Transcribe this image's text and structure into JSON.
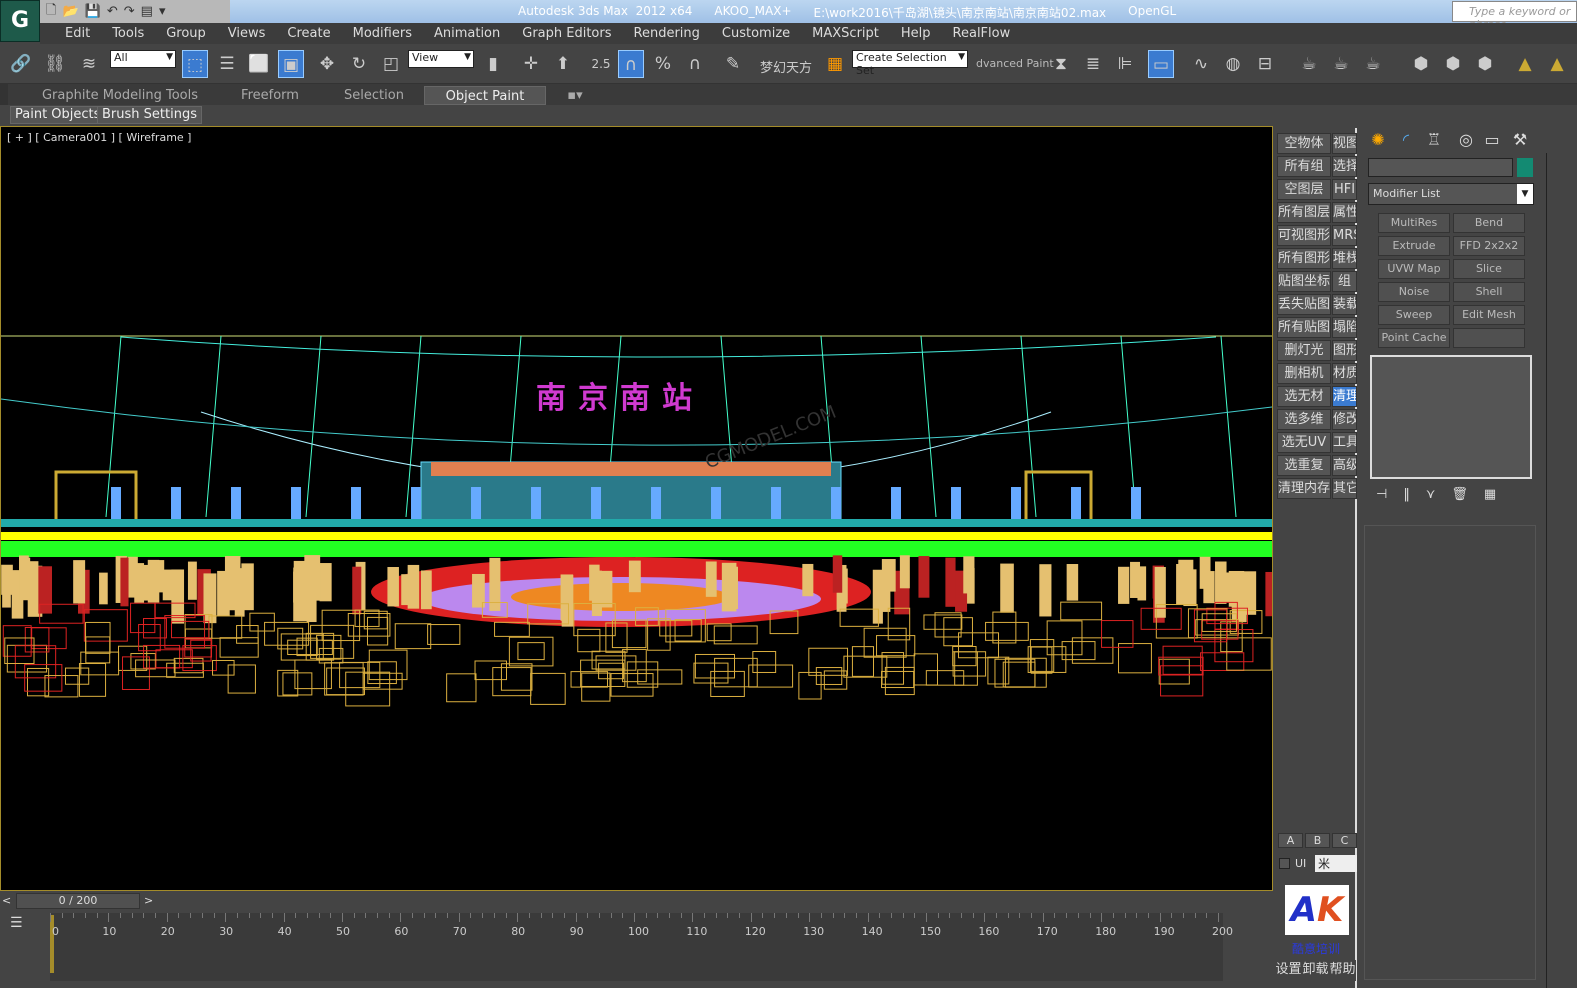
{
  "app": {
    "title_parts": [
      "Autodesk 3ds Max  2012 x64",
      "AKOO_MAX+",
      "E:\\work2016\\千岛湖\\镜头\\南京南站\\南京南站02.max",
      "OpenGL"
    ],
    "search_placeholder": "Type a keyword or phrase",
    "logo": "G"
  },
  "menu": [
    "Edit",
    "Tools",
    "Group",
    "Views",
    "Create",
    "Modifiers",
    "Animation",
    "Graph Editors",
    "Rendering",
    "Customize",
    "MAXScript",
    "Help",
    "RealFlow"
  ],
  "toolbar": {
    "filter_value": "All",
    "coord_value": "View",
    "snap_value": "2.5",
    "plugin_label": "梦幻天方",
    "selection_set_placeholder": "Create Selection Set",
    "advanced_paint": "dvanced Paint"
  },
  "ribbon": {
    "tabs": [
      "Graphite Modeling Tools",
      "Freeform",
      "Selection",
      "Object Paint"
    ],
    "active": "Object Paint",
    "subtabs": [
      "Paint Objects",
      "Brush Settings"
    ]
  },
  "viewport": {
    "label": "[ + ] [ Camera001 ] [ Wireframe ]",
    "sign_text": "南京南站",
    "watermark": "CGMODEL.COM"
  },
  "script_panel": {
    "col1": [
      "空物体",
      "所有组",
      "空图层",
      "所有图层",
      "可视图形",
      "所有图形",
      "贴图坐标",
      "丢失贴图",
      "所有贴图",
      "删灯光",
      "删相机",
      "选无材",
      "选多维",
      "选无UV",
      "选重复",
      "清理内存"
    ],
    "col2": [
      "视图",
      "选择",
      "HFI",
      "属性",
      "MRS",
      "堆栈",
      "组",
      "装载",
      "塌陷",
      "图形",
      "材质",
      "清理",
      "修改",
      "工具",
      "高级",
      "其它"
    ],
    "selected": "清理",
    "abc": [
      "A",
      "B",
      "C"
    ],
    "ui_label": "UI",
    "unit_value": "米",
    "logo_text": "AK",
    "brand": "酷意培训",
    "bottom": [
      "设置",
      "卸载",
      "帮助"
    ]
  },
  "command_panel": {
    "tabs": [
      "create-icon",
      "modify-icon",
      "hierarchy-icon",
      "motion-icon",
      "display-icon",
      "utilities-icon"
    ],
    "modifier_list": "Modifier List",
    "object_color": "#138a72",
    "modifiers": [
      "MultiRes",
      "Bend",
      "Extrude",
      "FFD 2x2x2",
      "UVW Map",
      "Slice",
      "Noise",
      "Shell",
      "Sweep",
      "Edit Mesh",
      "Point Cache",
      ""
    ]
  },
  "timeline": {
    "frame": "0 / 200",
    "prev": "<",
    "next": ">",
    "ticks": [
      "0",
      "10",
      "20",
      "30",
      "40",
      "50",
      "60",
      "70",
      "80",
      "90",
      "100",
      "110",
      "120",
      "130",
      "140",
      "150",
      "160",
      "170",
      "180",
      "190",
      "200"
    ]
  }
}
